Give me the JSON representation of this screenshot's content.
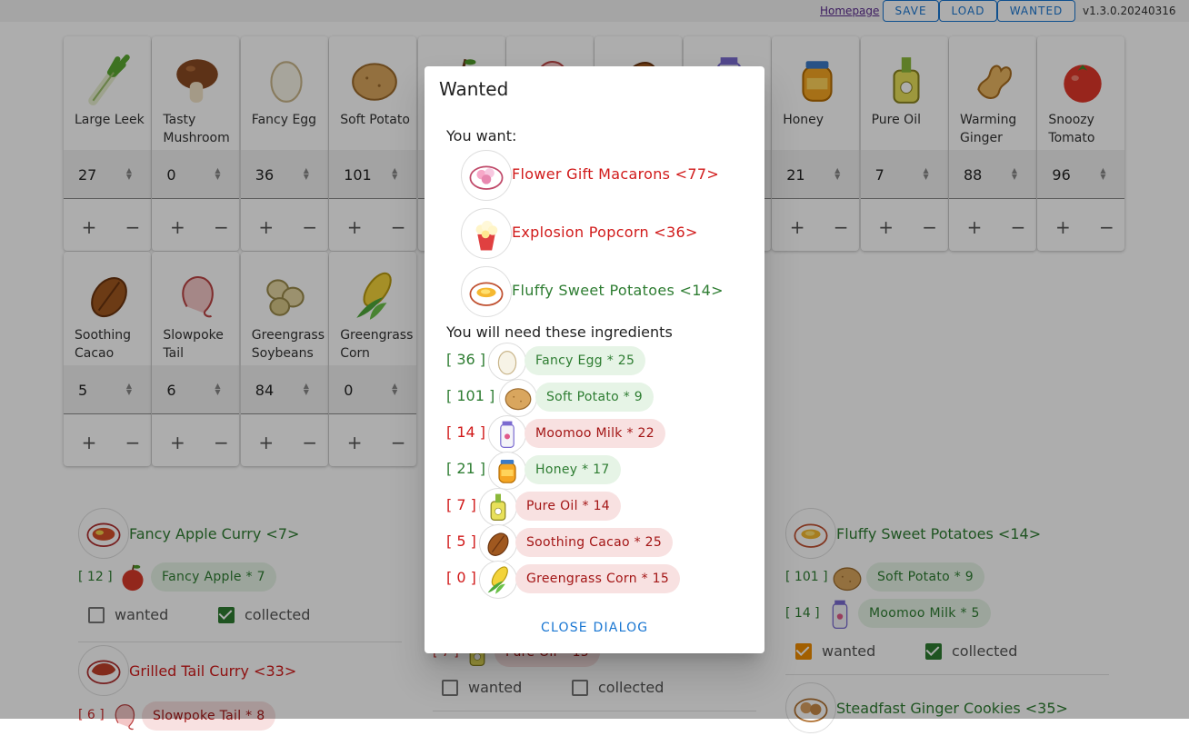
{
  "topbar": {
    "homepage": "Homepage",
    "save": "SAVE",
    "load": "LOAD",
    "wanted": "WANTED",
    "version": "v1.3.0.20240316"
  },
  "ingredients_row1": [
    {
      "name": "Large Leek",
      "value": "27",
      "icon": "leek-icon"
    },
    {
      "name": "Tasty Mushroom",
      "value": "0",
      "icon": "mushroom-icon"
    },
    {
      "name": "Fancy Egg",
      "value": "36",
      "icon": "egg-icon"
    },
    {
      "name": "Soft Potato",
      "value": "101",
      "icon": "potato-icon"
    },
    {
      "name": "",
      "value": "",
      "icon": "apple-icon"
    },
    {
      "name": "",
      "value": "",
      "icon": "tail-icon"
    },
    {
      "name": "",
      "value": "",
      "icon": "cacao-icon"
    },
    {
      "name": "",
      "value": "",
      "icon": "milk-icon"
    },
    {
      "name": "Honey",
      "value": "21",
      "icon": "honey-icon"
    },
    {
      "name": "Pure Oil",
      "value": "7",
      "icon": "oil-icon"
    },
    {
      "name": "Warming Ginger",
      "value": "88",
      "icon": "ginger-icon"
    },
    {
      "name": "Snoozy Tomato",
      "value": "96",
      "icon": "tomato-icon"
    }
  ],
  "ingredients_row2": [
    {
      "name": "Soothing Cacao",
      "value": "5",
      "icon": "cacao-icon"
    },
    {
      "name": "Slowpoke Tail",
      "value": "6",
      "icon": "tail-icon"
    },
    {
      "name": "Greengrass Soybeans",
      "value": "84",
      "icon": "soybean-icon"
    },
    {
      "name": "Greengrass Corn",
      "value": "0",
      "icon": "corn-icon"
    }
  ],
  "controls": {
    "plus": "+",
    "minus": "−",
    "spin": "⌃⌄"
  },
  "recipes": {
    "left1": {
      "title": "Fancy Apple Curry <7>",
      "count": "[ 12 ]",
      "chip": "Fancy Apple * 7",
      "wanted": "wanted",
      "collected": "collected"
    },
    "left2": {
      "title": "Grilled Tail Curry <33>",
      "count": "[ 6 ]",
      "chip": "Slowpoke Tail * 8"
    },
    "middle": {
      "count": "[ 7 ]",
      "chip": "Pure Oil * 15",
      "wanted": "wanted",
      "collected": "collected"
    },
    "right1": {
      "title": "Fluffy Sweet Potatoes <14>",
      "count1": "[ 101 ]",
      "chip1": "Soft Potato * 9",
      "count2": "[ 14 ]",
      "chip2": "Moomoo Milk * 5",
      "wanted": "wanted",
      "collected": "collected"
    },
    "right2": {
      "title": "Steadfast Ginger Cookies <35>"
    }
  },
  "dialog": {
    "title": "Wanted",
    "you_want": "You want:",
    "wants": [
      {
        "label": "Flower Gift Macarons <77>",
        "color": "red",
        "icon": "macaron-icon"
      },
      {
        "label": "Explosion Popcorn <36>",
        "color": "red",
        "icon": "popcorn-icon"
      },
      {
        "label": "Fluffy Sweet Potatoes <14>",
        "color": "green",
        "icon": "sweet-potato-dish-icon"
      }
    ],
    "need": "You will need these ingredients",
    "ingredients": [
      {
        "have": "[ 36 ]",
        "chip": "Fancy Egg * 25",
        "color": "green",
        "icon": "egg-icon"
      },
      {
        "have": "[ 101 ]",
        "chip": "Soft Potato * 9",
        "color": "green",
        "icon": "potato-icon"
      },
      {
        "have": "[ 14 ]",
        "chip": "Moomoo Milk * 22",
        "color": "red",
        "icon": "milk-icon"
      },
      {
        "have": "[ 21 ]",
        "chip": "Honey * 17",
        "color": "green",
        "icon": "honey-icon"
      },
      {
        "have": "[ 7 ]",
        "chip": "Pure Oil * 14",
        "color": "red",
        "icon": "oil-icon"
      },
      {
        "have": "[ 5 ]",
        "chip": "Soothing Cacao * 25",
        "color": "red",
        "icon": "cacao-icon"
      },
      {
        "have": "[ 0 ]",
        "chip": "Greengrass Corn * 15",
        "color": "red",
        "icon": "corn-icon"
      }
    ],
    "close": "CLOSE DIALOG"
  },
  "colors": {
    "green": "#2e7d32",
    "red": "#d11a1a",
    "accent": "#1976d2"
  }
}
